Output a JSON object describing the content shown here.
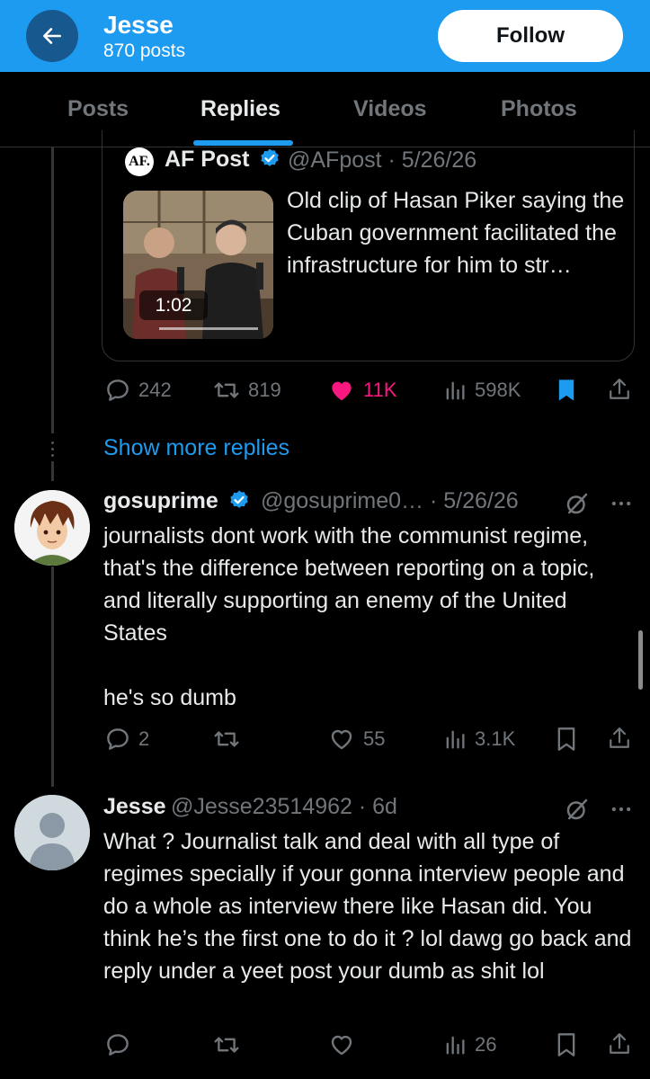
{
  "header": {
    "name": "Jesse",
    "post_count": "870 posts",
    "follow_label": "Follow"
  },
  "tabs": [
    {
      "label": "Posts"
    },
    {
      "label": "Replies"
    },
    {
      "label": "Videos"
    },
    {
      "label": "Photos"
    }
  ],
  "quoted_post": {
    "avatar_text": "AF.",
    "name": "AF Post",
    "handle_date": "@AFpost · 5/26/26",
    "video_duration": "1:02",
    "text": "Old clip of Hasan Piker saying the Cuban government facilitated the infrastructure for him to str…",
    "stats": {
      "replies": "242",
      "reposts": "819",
      "likes": "11K",
      "views": "598K"
    }
  },
  "show_more_label": "Show more replies",
  "posts": [
    {
      "name": "gosuprime",
      "handle_date": "@gosuprime0… · 5/26/26",
      "text": "journalists dont work with the communist regime, that's the difference between reporting on a topic, and literally supporting an enemy of the United States\n\nhe's so dumb",
      "stats": {
        "replies": "2",
        "reposts": "",
        "likes": "55",
        "views": "3.1K"
      }
    },
    {
      "name": "Jesse",
      "handle_date": "@Jesse23514962 · 6d",
      "text": "What ? Journalist talk and deal with all type of regimes specially if your gonna interview people and do a whole as interview there like Hasan did. You think he’s the first one to do it ? lol dawg go back and reply under a yeet post your dumb as shit lol",
      "stats": {
        "replies": "",
        "reposts": "",
        "likes": "",
        "views": "26"
      }
    }
  ],
  "colors": {
    "accent": "#1d9bf0",
    "like_active": "#f91880",
    "background": "#000000",
    "muted": "#71767b"
  }
}
